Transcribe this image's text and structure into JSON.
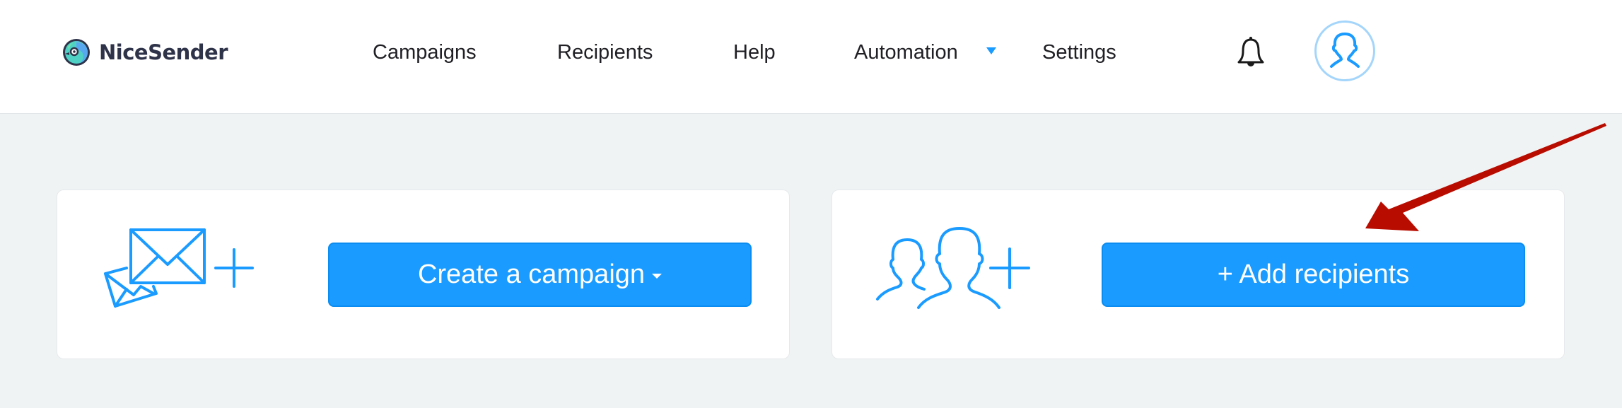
{
  "brand": {
    "name": "NiceSender",
    "logo_icon": "nicesender-logo-icon"
  },
  "nav": {
    "items": [
      {
        "label": "Campaigns"
      },
      {
        "label": "Recipients"
      },
      {
        "label": "Help"
      },
      {
        "label": "Automation",
        "has_dropdown": true
      },
      {
        "label": "Settings"
      }
    ]
  },
  "header_actions": {
    "notifications_icon": "bell-icon",
    "profile_icon": "user-avatar-icon"
  },
  "cards": [
    {
      "icon": "envelopes-plus-icon",
      "button_label": "Create a campaign",
      "button_has_dropdown": true
    },
    {
      "icon": "people-plus-icon",
      "button_label": "+ Add recipients"
    }
  ],
  "annotation": {
    "type": "arrow",
    "points_to": "add-recipients-button",
    "color": "#b30000"
  },
  "colors": {
    "accent": "#1a9bff",
    "header_bg": "#ffffff",
    "page_bg": "#f0f3f4",
    "text": "#1f1f24",
    "brand_text": "#2f3349",
    "avatar_ring": "#a4d5fb"
  }
}
